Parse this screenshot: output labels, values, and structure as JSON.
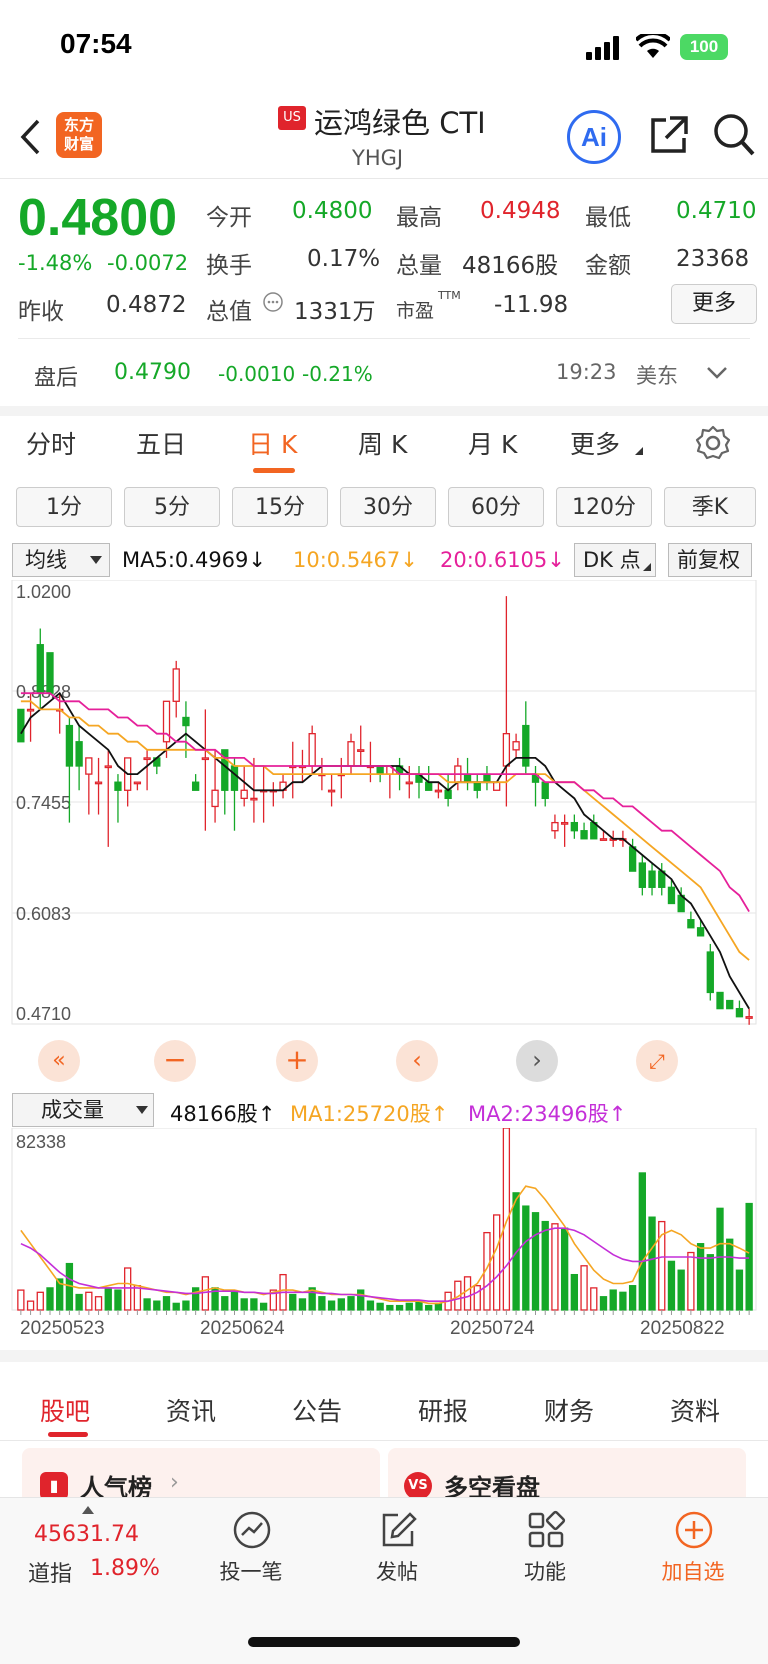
{
  "status_bar": {
    "time": "07:54",
    "battery": "100"
  },
  "header": {
    "market_badge": "US",
    "name": "运鸿绿色 CTI",
    "code": "YHGJ",
    "logo_text_1": "东方",
    "logo_text_2": "财富",
    "ai_label": "Ai"
  },
  "quote": {
    "price": "0.4800",
    "change_pct": "-1.48%",
    "change": "-0.0072",
    "open_label": "今开",
    "open": "0.4800",
    "high_label": "最高",
    "high": "0.4948",
    "low_label": "最低",
    "low": "0.4710",
    "turnover_label": "换手",
    "turnover": "0.17%",
    "volume_label": "总量",
    "volume": "48166股",
    "amount_label": "金额",
    "amount": "23368",
    "prev_close_label": "昨收",
    "prev_close": "0.4872",
    "market_cap_label": "总值",
    "market_cap": "1331万",
    "pe_label": "市盈",
    "pe_sup": "TTM",
    "pe": "-11.98",
    "more_label": "更多"
  },
  "after_hours": {
    "label": "盘后",
    "price": "0.4790",
    "change": "-0.0010",
    "pct": "-0.21%",
    "time": "19:23",
    "zone": "美东"
  },
  "period_tabs": [
    "分时",
    "五日",
    "日 K",
    "周 K",
    "月 K",
    "更多"
  ],
  "interval_pills": [
    "1分",
    "5分",
    "15分",
    "30分",
    "60分",
    "120分",
    "季K"
  ],
  "indicators": {
    "select": "均线",
    "ma5": "MA5:0.4969",
    "ma10": "10:0.5467",
    "ma20": "20:0.6105",
    "dk": "DK 点",
    "adjust": "前复权",
    "arrow": "↓",
    "up_arrow": "↑",
    "vol_select": "成交量",
    "vol": "48166股",
    "vol_ma1": "MA1:25720股",
    "vol_ma2": "MA2:23496股"
  },
  "colors": {
    "up": "#e0242c",
    "down": "#15a828",
    "ma5": "#111111",
    "ma10": "#f5a623",
    "ma20": "#e5209a",
    "accent": "#f26522"
  },
  "chart_data": [
    {
      "type": "candlestick",
      "y_ticks": [
        "1.0200",
        "0.8828",
        "0.7455",
        "0.6083",
        "0.4710"
      ],
      "ylim": [
        0.471,
        1.02
      ],
      "series": [
        {
          "name": "K",
          "ohlc": [
            [
              0.86,
              0.86,
              0.84,
              0.82
            ],
            [
              0.86,
              0.88,
              0.82,
              0.86
            ],
            [
              0.94,
              0.96,
              0.86,
              0.88
            ],
            [
              0.93,
              0.93,
              0.88,
              0.88
            ],
            [
              0.86,
              0.88,
              0.83,
              0.86
            ],
            [
              0.84,
              0.85,
              0.72,
              0.79
            ],
            [
              0.82,
              0.84,
              0.76,
              0.79
            ],
            [
              0.78,
              0.8,
              0.73,
              0.8
            ],
            [
              0.77,
              0.8,
              0.73,
              0.77
            ],
            [
              0.79,
              0.81,
              0.69,
              0.79
            ],
            [
              0.77,
              0.78,
              0.72,
              0.76
            ],
            [
              0.76,
              0.79,
              0.74,
              0.8
            ],
            [
              0.77,
              0.77,
              0.76,
              0.77
            ],
            [
              0.8,
              0.81,
              0.76,
              0.8
            ],
            [
              0.8,
              0.8,
              0.78,
              0.79
            ],
            [
              0.82,
              0.87,
              0.8,
              0.87
            ],
            [
              0.87,
              0.92,
              0.85,
              0.91
            ],
            [
              0.85,
              0.87,
              0.8,
              0.84
            ],
            [
              0.77,
              0.78,
              0.76,
              0.76
            ],
            [
              0.8,
              0.86,
              0.71,
              0.8
            ],
            [
              0.74,
              0.81,
              0.72,
              0.76
            ],
            [
              0.81,
              0.81,
              0.73,
              0.76
            ],
            [
              0.79,
              0.8,
              0.71,
              0.76
            ],
            [
              0.75,
              0.79,
              0.74,
              0.76
            ],
            [
              0.75,
              0.8,
              0.72,
              0.75
            ],
            [
              0.76,
              0.79,
              0.72,
              0.76
            ],
            [
              0.76,
              0.77,
              0.74,
              0.76
            ],
            [
              0.76,
              0.78,
              0.75,
              0.77
            ],
            [
              0.79,
              0.82,
              0.75,
              0.79
            ],
            [
              0.79,
              0.81,
              0.77,
              0.79
            ],
            [
              0.79,
              0.84,
              0.78,
              0.83
            ],
            [
              0.78,
              0.8,
              0.76,
              0.78
            ],
            [
              0.76,
              0.78,
              0.74,
              0.76
            ],
            [
              0.78,
              0.8,
              0.75,
              0.78
            ],
            [
              0.79,
              0.83,
              0.78,
              0.82
            ],
            [
              0.81,
              0.84,
              0.79,
              0.81
            ],
            [
              0.79,
              0.82,
              0.77,
              0.79
            ],
            [
              0.79,
              0.79,
              0.77,
              0.78
            ],
            [
              0.78,
              0.79,
              0.75,
              0.79
            ],
            [
              0.79,
              0.8,
              0.76,
              0.78
            ],
            [
              0.77,
              0.79,
              0.75,
              0.77
            ],
            [
              0.78,
              0.79,
              0.75,
              0.77
            ],
            [
              0.77,
              0.79,
              0.76,
              0.76
            ],
            [
              0.76,
              0.77,
              0.75,
              0.76
            ],
            [
              0.76,
              0.78,
              0.74,
              0.75
            ],
            [
              0.77,
              0.8,
              0.76,
              0.79
            ],
            [
              0.78,
              0.8,
              0.76,
              0.77
            ],
            [
              0.77,
              0.78,
              0.75,
              0.76
            ],
            [
              0.78,
              0.79,
              0.76,
              0.77
            ],
            [
              0.76,
              0.77,
              0.76,
              0.77
            ],
            [
              0.79,
              1.0,
              0.74,
              0.83
            ],
            [
              0.81,
              0.83,
              0.8,
              0.82
            ],
            [
              0.84,
              0.87,
              0.78,
              0.79
            ],
            [
              0.78,
              0.79,
              0.74,
              0.77
            ],
            [
              0.77,
              0.77,
              0.74,
              0.75
            ],
            [
              0.71,
              0.73,
              0.7,
              0.72
            ],
            [
              0.72,
              0.73,
              0.69,
              0.72
            ],
            [
              0.72,
              0.73,
              0.7,
              0.71
            ],
            [
              0.71,
              0.72,
              0.7,
              0.7
            ],
            [
              0.72,
              0.73,
              0.7,
              0.7
            ],
            [
              0.7,
              0.71,
              0.7,
              0.7
            ],
            [
              0.7,
              0.71,
              0.69,
              0.7
            ],
            [
              0.7,
              0.71,
              0.69,
              0.7
            ],
            [
              0.69,
              0.7,
              0.66,
              0.66
            ],
            [
              0.67,
              0.68,
              0.63,
              0.64
            ],
            [
              0.66,
              0.67,
              0.63,
              0.64
            ],
            [
              0.66,
              0.67,
              0.63,
              0.64
            ],
            [
              0.64,
              0.65,
              0.62,
              0.62
            ],
            [
              0.63,
              0.64,
              0.61,
              0.61
            ],
            [
              0.6,
              0.61,
              0.59,
              0.59
            ],
            [
              0.59,
              0.6,
              0.58,
              0.58
            ],
            [
              0.56,
              0.57,
              0.5,
              0.51
            ],
            [
              0.51,
              0.51,
              0.49,
              0.49
            ],
            [
              0.5,
              0.5,
              0.49,
              0.49
            ],
            [
              0.49,
              0.5,
              0.48,
              0.48
            ],
            [
              0.48,
              0.49,
              0.47,
              0.48
            ]
          ]
        }
      ],
      "ma": [
        {
          "name": "MA5",
          "color": "#111111",
          "values": [
            0.83,
            0.85,
            0.86,
            0.87,
            0.88,
            0.86,
            0.84,
            0.83,
            0.82,
            0.81,
            0.79,
            0.78,
            0.78,
            0.79,
            0.8,
            0.81,
            0.82,
            0.83,
            0.82,
            0.81,
            0.8,
            0.79,
            0.78,
            0.77,
            0.76,
            0.76,
            0.76,
            0.76,
            0.77,
            0.77,
            0.78,
            0.79,
            0.79,
            0.79,
            0.79,
            0.79,
            0.79,
            0.79,
            0.79,
            0.79,
            0.78,
            0.78,
            0.77,
            0.77,
            0.76,
            0.77,
            0.77,
            0.77,
            0.77,
            0.77,
            0.79,
            0.8,
            0.8,
            0.8,
            0.79,
            0.77,
            0.76,
            0.75,
            0.73,
            0.72,
            0.71,
            0.7,
            0.7,
            0.69,
            0.68,
            0.67,
            0.66,
            0.65,
            0.63,
            0.62,
            0.6,
            0.58,
            0.56,
            0.53,
            0.51,
            0.49
          ]
        },
        {
          "name": "MA10",
          "color": "#f5a623",
          "values": [
            0.87,
            0.87,
            0.86,
            0.86,
            0.86,
            0.85,
            0.85,
            0.84,
            0.84,
            0.83,
            0.83,
            0.82,
            0.82,
            0.81,
            0.81,
            0.81,
            0.81,
            0.81,
            0.81,
            0.81,
            0.8,
            0.8,
            0.79,
            0.79,
            0.79,
            0.79,
            0.78,
            0.78,
            0.78,
            0.78,
            0.78,
            0.78,
            0.78,
            0.78,
            0.78,
            0.78,
            0.78,
            0.78,
            0.78,
            0.78,
            0.78,
            0.78,
            0.78,
            0.78,
            0.77,
            0.77,
            0.77,
            0.77,
            0.77,
            0.77,
            0.77,
            0.78,
            0.78,
            0.78,
            0.78,
            0.77,
            0.77,
            0.77,
            0.76,
            0.75,
            0.74,
            0.73,
            0.72,
            0.71,
            0.7,
            0.69,
            0.68,
            0.67,
            0.66,
            0.65,
            0.64,
            0.62,
            0.6,
            0.58,
            0.56,
            0.55
          ]
        },
        {
          "name": "MA20",
          "color": "#e5209a",
          "values": [
            0.88,
            0.88,
            0.88,
            0.88,
            0.87,
            0.87,
            0.87,
            0.86,
            0.86,
            0.86,
            0.85,
            0.85,
            0.84,
            0.84,
            0.83,
            0.83,
            0.82,
            0.82,
            0.81,
            0.81,
            0.81,
            0.8,
            0.8,
            0.8,
            0.79,
            0.79,
            0.79,
            0.79,
            0.79,
            0.79,
            0.79,
            0.79,
            0.79,
            0.79,
            0.79,
            0.79,
            0.79,
            0.79,
            0.79,
            0.78,
            0.78,
            0.78,
            0.78,
            0.78,
            0.78,
            0.78,
            0.78,
            0.78,
            0.78,
            0.78,
            0.78,
            0.78,
            0.78,
            0.78,
            0.77,
            0.77,
            0.77,
            0.77,
            0.76,
            0.76,
            0.75,
            0.75,
            0.74,
            0.74,
            0.73,
            0.72,
            0.71,
            0.71,
            0.7,
            0.69,
            0.68,
            0.67,
            0.66,
            0.64,
            0.63,
            0.61
          ]
        }
      ]
    },
    {
      "type": "bar",
      "y_ticks": [
        "82338"
      ],
      "ylim": [
        0,
        82338
      ],
      "x_ticks": [
        "20250523",
        "20250624",
        "20250724",
        "20250822"
      ],
      "values": [
        9000,
        4000,
        8000,
        10000,
        14000,
        21000,
        7000,
        8000,
        6000,
        10000,
        9000,
        19000,
        11000,
        5000,
        4000,
        6000,
        3000,
        4000,
        10000,
        15000,
        10000,
        6000,
        8000,
        5000,
        5000,
        3000,
        9000,
        16000,
        7000,
        5000,
        10000,
        6000,
        4000,
        5000,
        6000,
        9000,
        4000,
        3000,
        2000,
        2000,
        3000,
        4000,
        2000,
        3000,
        8000,
        13000,
        15000,
        11000,
        35000,
        43000,
        82338,
        53000,
        47000,
        44000,
        40000,
        39000,
        37000,
        16000,
        20000,
        10000,
        6000,
        9000,
        8000,
        11000,
        62000,
        42000,
        40000,
        22000,
        18000,
        26000,
        30000,
        25000,
        46000,
        32000,
        18000,
        48166
      ],
      "up": [
        1,
        1,
        1,
        0,
        0,
        0,
        0,
        1,
        1,
        0,
        0,
        1,
        1,
        0,
        0,
        0,
        0,
        0,
        0,
        1,
        0,
        0,
        0,
        0,
        0,
        0,
        1,
        1,
        0,
        0,
        0,
        0,
        0,
        0,
        0,
        0,
        0,
        0,
        0,
        0,
        0,
        0,
        0,
        0,
        1,
        1,
        1,
        1,
        1,
        1,
        1,
        0,
        0,
        0,
        0,
        1,
        0,
        0,
        1,
        1,
        0,
        0,
        0,
        0,
        0,
        0,
        1,
        0,
        0,
        1,
        0,
        0,
        0,
        0,
        0,
        0
      ],
      "ma1": [
        36000,
        30000,
        24000,
        18000,
        12000,
        11000,
        10000,
        10000,
        10000,
        11000,
        12000,
        12000,
        11000,
        10000,
        9000,
        8000,
        8000,
        7000,
        8000,
        9000,
        10000,
        9000,
        9000,
        8000,
        8000,
        7000,
        8000,
        9000,
        9000,
        8000,
        9000,
        8000,
        7000,
        7000,
        7000,
        7000,
        6000,
        5000,
        4000,
        4000,
        4000,
        4000,
        3000,
        3000,
        4000,
        6000,
        9000,
        12000,
        19000,
        28000,
        40000,
        50000,
        56000,
        55000,
        50000,
        44000,
        38000,
        30000,
        24000,
        18000,
        14000,
        12000,
        12000,
        13000,
        22000,
        28000,
        34000,
        36000,
        34000,
        30000,
        28000,
        28000,
        30000,
        30000,
        28000,
        25720
      ],
      "ma2": [
        30000,
        28000,
        25000,
        21000,
        17000,
        14000,
        12000,
        11000,
        10000,
        10000,
        10000,
        10000,
        10000,
        9500,
        9000,
        8500,
        8000,
        7500,
        7500,
        8000,
        8500,
        8500,
        8500,
        8000,
        8000,
        7500,
        7500,
        8000,
        8000,
        8000,
        8000,
        7500,
        7500,
        7000,
        7000,
        6500,
        6000,
        5500,
        5000,
        4500,
        4500,
        4500,
        4000,
        4000,
        4000,
        5000,
        6000,
        8000,
        11000,
        15000,
        20000,
        26000,
        31000,
        34000,
        36000,
        37000,
        37000,
        36000,
        34000,
        31000,
        28000,
        25000,
        23000,
        22000,
        22000,
        23000,
        24000,
        24000,
        24000,
        24000,
        23500,
        23500,
        24000,
        24000,
        23500,
        23496
      ]
    }
  ],
  "news_tabs": [
    "股吧",
    "资讯",
    "公告",
    "研报",
    "财务",
    "资料"
  ],
  "cards": {
    "left": "人气榜",
    "right": "多空看盘",
    "right_badge": "VS"
  },
  "bottom_nav": {
    "index_value": "45631.74",
    "index_name": "道指",
    "index_pct": "1.89%",
    "items": [
      "投一笔",
      "发帖",
      "功能",
      "加自选"
    ]
  }
}
